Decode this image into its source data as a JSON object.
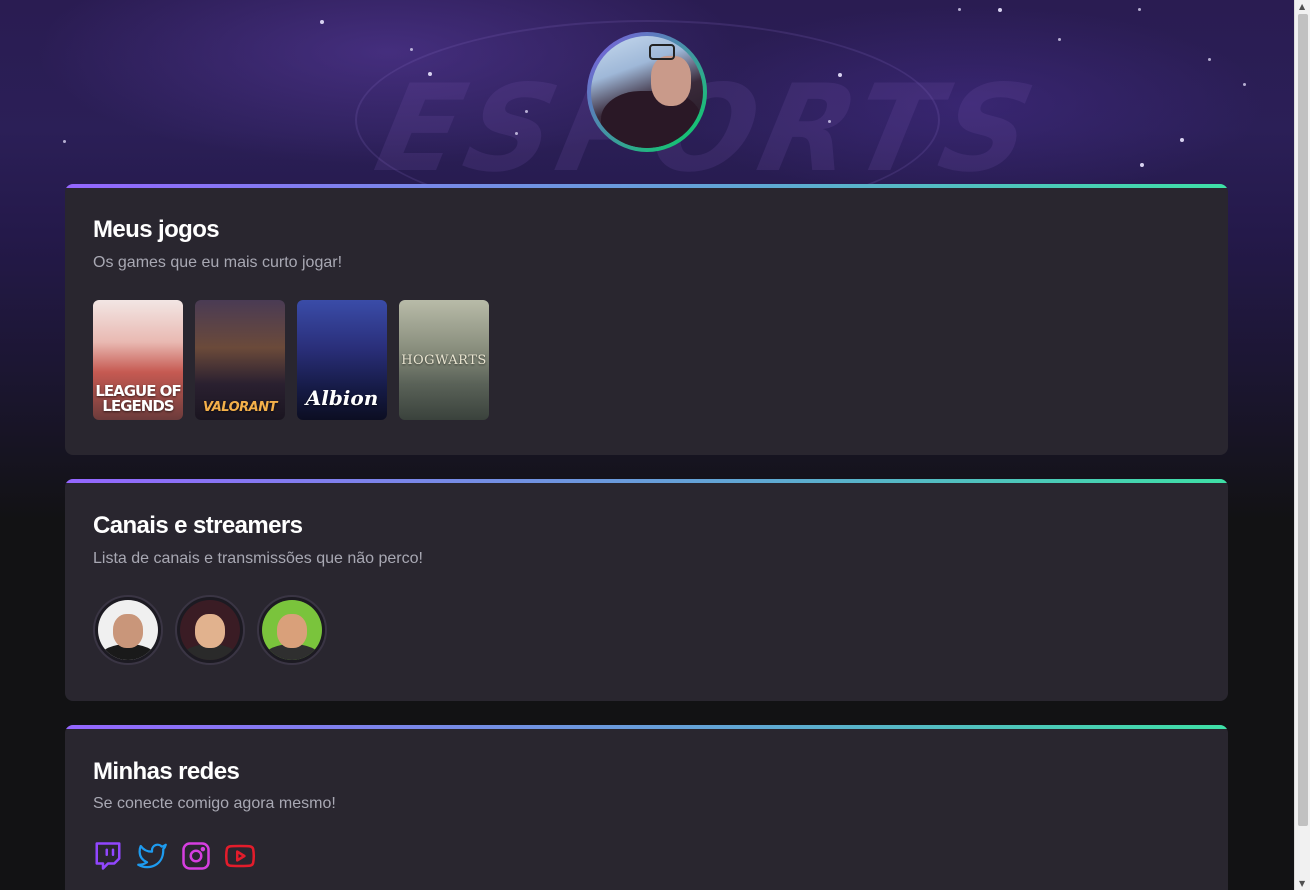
{
  "profile": {
    "avatar_icon": "avatar-photo"
  },
  "hero": {
    "watermark_text": "ESPORTS"
  },
  "games_section": {
    "title": "Meus jogos",
    "subtitle": "Os games que eu mais curto jogar!",
    "items": [
      {
        "name": "LEAGUE OF LEGENDS",
        "line1": "LEAGUE OF",
        "line2": "LEGENDS"
      },
      {
        "name": "VALORANT"
      },
      {
        "name": "Albion"
      },
      {
        "name": "HOGWARTS"
      }
    ]
  },
  "streamers_section": {
    "title": "Canais e streamers",
    "subtitle": "Lista de canais e transmissões que não perco!",
    "items": [
      {
        "icon": "streamer-avatar-1"
      },
      {
        "icon": "streamer-avatar-2"
      },
      {
        "icon": "streamer-avatar-3"
      }
    ]
  },
  "social_section": {
    "title": "Minhas redes",
    "subtitle": "Se conecte comigo agora mesmo!",
    "items": [
      {
        "icon": "twitch-icon",
        "color": "#9146ff"
      },
      {
        "icon": "twitter-icon",
        "color": "#1d9bf0"
      },
      {
        "icon": "instagram-icon",
        "color": "#e1306c"
      },
      {
        "icon": "youtube-icon",
        "color": "#ff0000"
      }
    ]
  },
  "colors": {
    "accent_gradient_start": "#9466ff",
    "accent_gradient_end": "#3ee0a6",
    "card_bg": "#29262f",
    "page_bg": "#121214"
  }
}
